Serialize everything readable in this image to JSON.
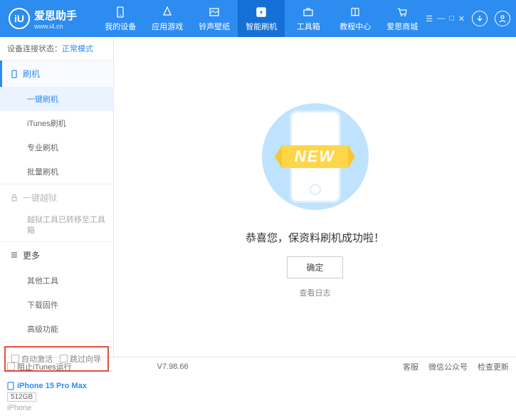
{
  "brand": {
    "title": "爱思助手",
    "url": "www.i4.cn",
    "logo_letter": "iU"
  },
  "nav": {
    "items": [
      {
        "label": "我的设备"
      },
      {
        "label": "应用游戏"
      },
      {
        "label": "铃声壁纸"
      },
      {
        "label": "智能刷机"
      },
      {
        "label": "工具箱"
      },
      {
        "label": "教程中心"
      },
      {
        "label": "爱思商城"
      }
    ]
  },
  "status": {
    "label": "设备连接状态：",
    "mode": "正常模式"
  },
  "sidebar": {
    "groups": [
      {
        "title": "刷机",
        "subs": [
          "一键刷机",
          "iTunes刷机",
          "专业刷机",
          "批量刷机"
        ]
      },
      {
        "title": "一键越狱",
        "locked": true,
        "subs": [
          "越狱工具已转移至工具箱"
        ]
      },
      {
        "title": "更多",
        "subs": [
          "其他工具",
          "下载固件",
          "高级功能"
        ]
      }
    ]
  },
  "options": {
    "auto_activate": "自动激活",
    "skip_setup": "跳过向导"
  },
  "device": {
    "name": "iPhone 15 Pro Max",
    "storage": "512GB",
    "type": "iPhone"
  },
  "main": {
    "banner": "NEW",
    "success": "恭喜您，保资料刷机成功啦！",
    "confirm": "确定",
    "log_link": "查看日志"
  },
  "footer": {
    "block_itunes": "阻止iTunes运行",
    "version": "V7.98.66",
    "links": [
      "客服",
      "微信公众号",
      "检查更新"
    ]
  }
}
